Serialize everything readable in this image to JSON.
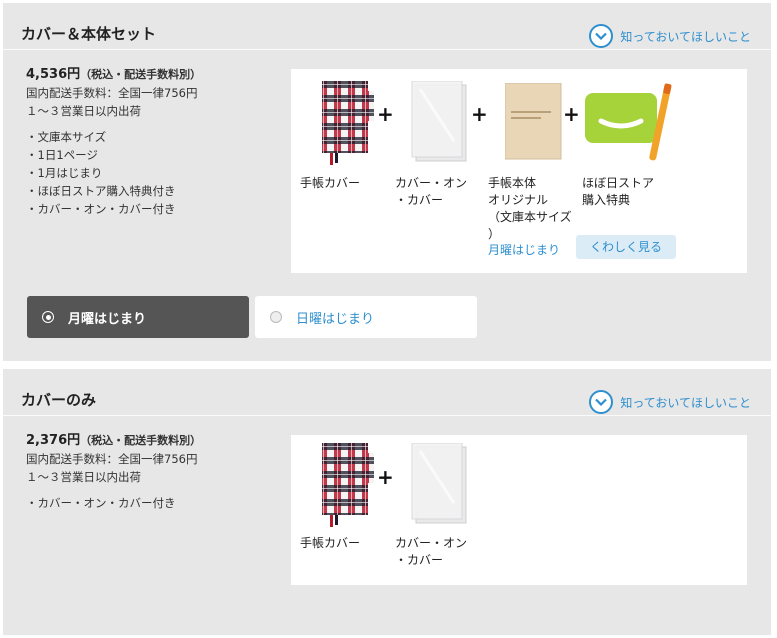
{
  "sections": [
    {
      "title": "カバー＆本体セット",
      "note_link": "知っておいてほしいこと",
      "price": "4,536円",
      "price_note": "（税込・配送手数料別）",
      "shipping_fee": "国内配送手数料：全国一律756円",
      "shipping_time": "１～３営業日以内出荷",
      "features": [
        "・文庫本サイズ",
        "・1日1ページ",
        "・1月はじまり",
        "・ほぼ日ストア購入特典付き",
        "・カバー・オン・カバー付き"
      ],
      "products": {
        "cover": "手帳カバー",
        "cover_on_cover": [
          "カバー・オン",
          "・カバー"
        ],
        "book": [
          "手帳本体",
          "オリジナル",
          "（文庫本サイズ",
          "）"
        ],
        "book_start": "月曜はじまり",
        "bonus": [
          "ほぼ日ストア",
          "購入特典"
        ],
        "details_button": "くわしく見る"
      },
      "start_options": [
        {
          "label": "月曜はじまり",
          "selected": true
        },
        {
          "label": "日曜はじまり",
          "selected": false
        }
      ]
    },
    {
      "title": "カバーのみ",
      "note_link": "知っておいてほしいこと",
      "price": "2,376円",
      "price_note": "（税込・配送手数料別）",
      "shipping_fee": "国内配送手数料：全国一律756円",
      "shipping_time": "１～３営業日以内出荷",
      "features": [
        "・カバー・オン・カバー付き"
      ],
      "products": {
        "cover": "手帳カバー",
        "cover_on_cover": [
          "カバー・オン",
          "・カバー"
        ]
      }
    }
  ],
  "colors": {
    "accent": "#2e8fce",
    "panel_bg": "#e7e7e7",
    "selected_bg": "#555555"
  }
}
